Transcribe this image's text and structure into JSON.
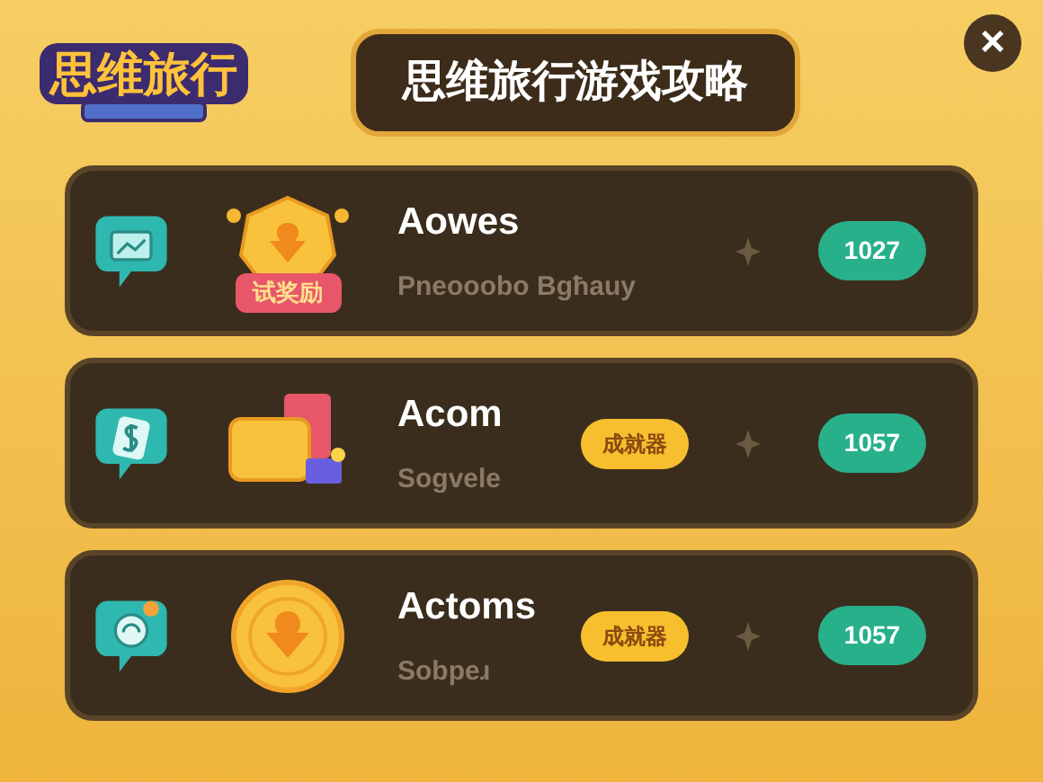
{
  "logo": {
    "text": "思维旅行"
  },
  "header": {
    "title": "思维旅行游戏攻略",
    "close": "×"
  },
  "rows": [
    {
      "kind": "medal",
      "ribbon": "试奖励",
      "title": "Aowes",
      "subtitle": "Pneooobo Bgħauy",
      "count": "1027"
    },
    {
      "kind": "box",
      "tag": "成就器",
      "title": "Acom",
      "subtitle": "Sogvele",
      "count": "1057"
    },
    {
      "kind": "coin",
      "tag": "成就器",
      "title": "Actoms",
      "subtitle": "Sobpeɹ",
      "count": "1057"
    }
  ]
}
